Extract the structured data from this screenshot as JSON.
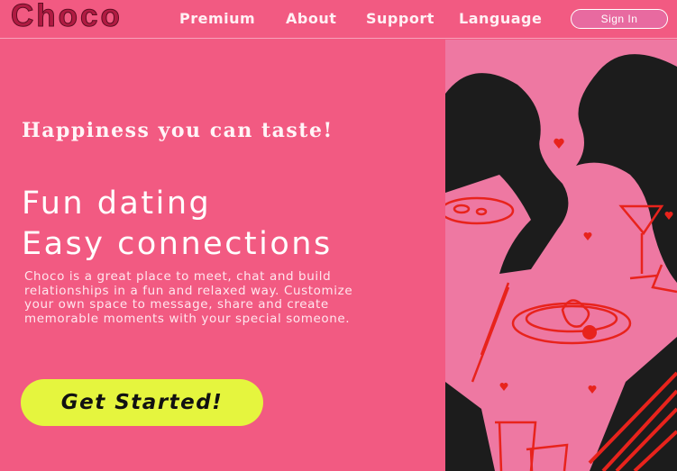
{
  "nav": {
    "logo": "Choco",
    "links": [
      "Premium",
      "About",
      "Support",
      "Language"
    ],
    "signin": "Sign In"
  },
  "hero": {
    "tagline": "Happiness you can taste!",
    "headline_line1": "Fun dating",
    "headline_line2": "Easy connections",
    "description": "Choco is a great place to meet, chat and build relationships in a fun and relaxed way. Customize your own space to message, share and create memorable moments with your special someone.",
    "cta": "Get Started!"
  },
  "colors": {
    "background": "#f25a82",
    "logo": "#b01b42",
    "cta": "#e5f53e",
    "illustration_pink": "#ee78a2",
    "illustration_red": "#e8231c",
    "illustration_dark": "#1c1c1c"
  }
}
